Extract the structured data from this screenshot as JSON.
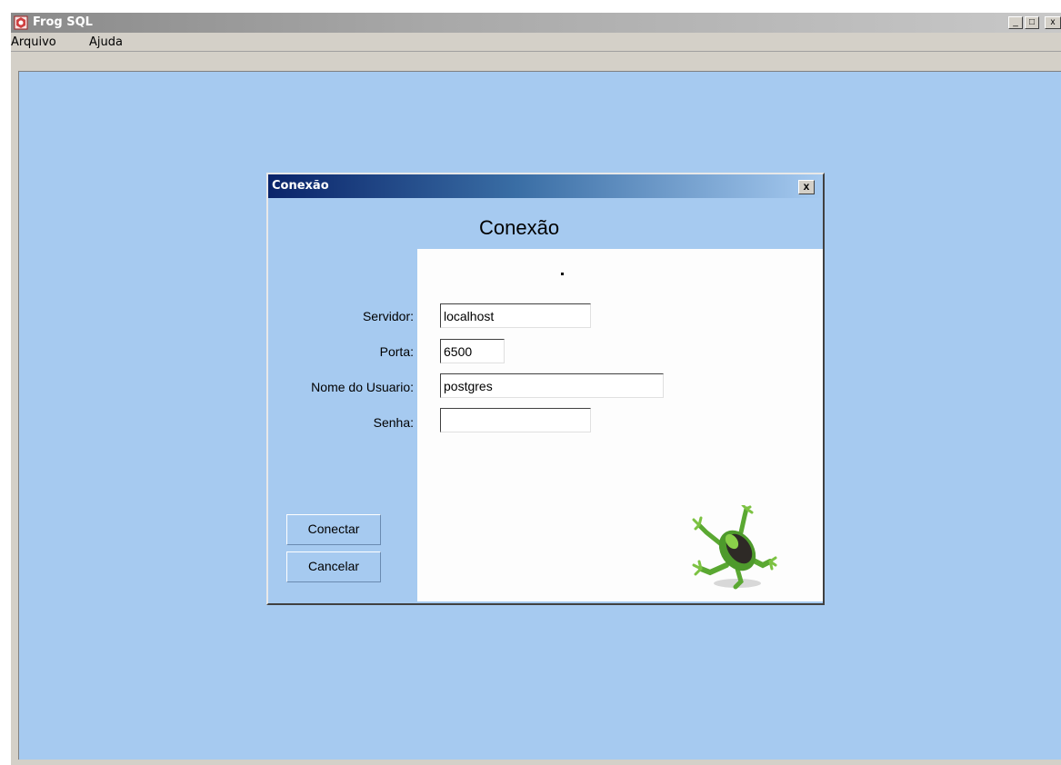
{
  "app": {
    "title": "Frog SQL",
    "window_buttons": {
      "minimize": "_",
      "maximize": "□",
      "close": "x"
    }
  },
  "menubar": {
    "items": [
      {
        "label": "Arquivo"
      },
      {
        "label": "Ajuda"
      }
    ]
  },
  "dialog": {
    "title": "Conexão",
    "heading": "Conexão",
    "close_glyph": "x",
    "status_text": "",
    "fields": {
      "server": {
        "label": "Servidor:",
        "value": "localhost"
      },
      "port": {
        "label": "Porta:",
        "value": "6500"
      },
      "username": {
        "label": "Nome do Usuario:",
        "value": "postgres"
      },
      "password": {
        "label": "Senha:",
        "value": ""
      }
    },
    "buttons": {
      "connect": "Conectar",
      "cancel": "Cancelar"
    },
    "logo_icon": "frog-icon"
  },
  "colors": {
    "desktop_bg": "#a6caf0",
    "dialog_title_start": "#0a246a",
    "panel_bg": "#fdfdfd"
  }
}
